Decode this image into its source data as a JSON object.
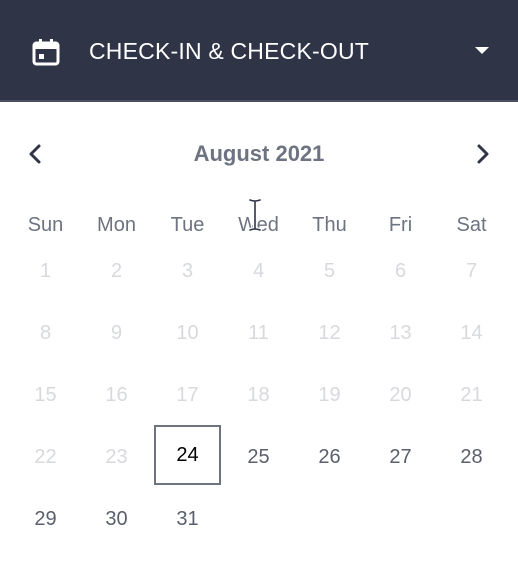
{
  "header": {
    "icon": "calendar-icon",
    "title": "CHECK-IN & CHECK-OUT",
    "dropdown_icon": "caret-down-icon",
    "background": "#2f3446"
  },
  "calendar": {
    "month_label": "August 2021",
    "prev_icon": "chevron-left-icon",
    "next_icon": "chevron-right-icon",
    "weekdays": [
      "Sun",
      "Mon",
      "Tue",
      "Wed",
      "Thu",
      "Fri",
      "Sat"
    ],
    "weeks": [
      [
        {
          "d": "1",
          "s": "disabled"
        },
        {
          "d": "2",
          "s": "disabled"
        },
        {
          "d": "3",
          "s": "disabled"
        },
        {
          "d": "4",
          "s": "disabled"
        },
        {
          "d": "5",
          "s": "disabled"
        },
        {
          "d": "6",
          "s": "disabled"
        },
        {
          "d": "7",
          "s": "disabled"
        }
      ],
      [
        {
          "d": "8",
          "s": "disabled"
        },
        {
          "d": "9",
          "s": "disabled"
        },
        {
          "d": "10",
          "s": "disabled"
        },
        {
          "d": "11",
          "s": "disabled"
        },
        {
          "d": "12",
          "s": "disabled"
        },
        {
          "d": "13",
          "s": "disabled"
        },
        {
          "d": "14",
          "s": "disabled"
        }
      ],
      [
        {
          "d": "15",
          "s": "disabled"
        },
        {
          "d": "16",
          "s": "disabled"
        },
        {
          "d": "17",
          "s": "disabled"
        },
        {
          "d": "18",
          "s": "disabled"
        },
        {
          "d": "19",
          "s": "disabled"
        },
        {
          "d": "20",
          "s": "disabled"
        },
        {
          "d": "21",
          "s": "disabled"
        }
      ],
      [
        {
          "d": "22",
          "s": "disabled"
        },
        {
          "d": "23",
          "s": "disabled"
        },
        {
          "d": "24",
          "s": "selected"
        },
        {
          "d": "25",
          "s": "enabled"
        },
        {
          "d": "26",
          "s": "enabled"
        },
        {
          "d": "27",
          "s": "enabled"
        },
        {
          "d": "28",
          "s": "enabled"
        }
      ],
      [
        {
          "d": "29",
          "s": "enabled"
        },
        {
          "d": "30",
          "s": "enabled"
        },
        {
          "d": "31",
          "s": "enabled"
        }
      ]
    ],
    "colors": {
      "text": "#6e7381",
      "enabled_day": "#5a5f6b",
      "disabled_day": "#d7d9dd",
      "selected_border": "#6e7381"
    }
  }
}
